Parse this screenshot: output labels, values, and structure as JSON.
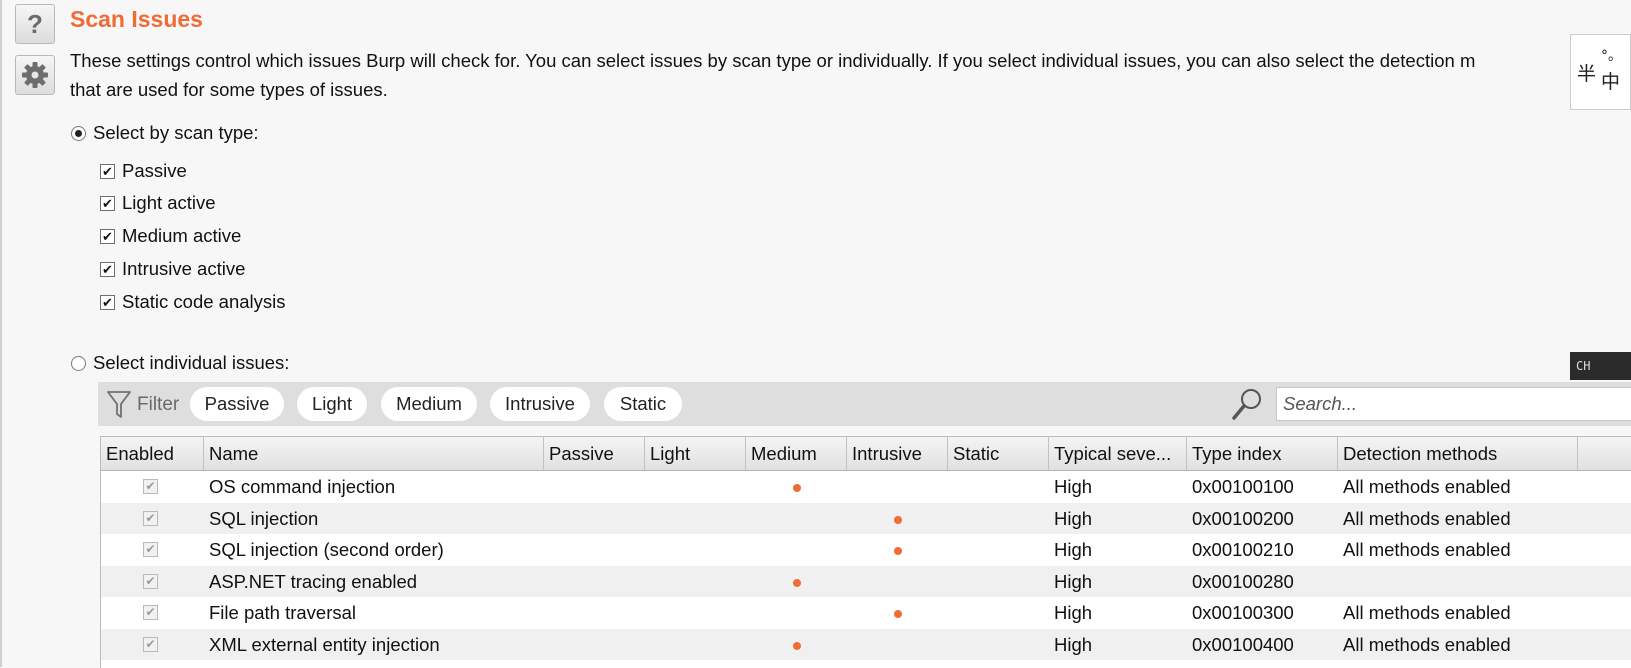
{
  "page": {
    "title": "Scan Issues",
    "description_line1": "These settings control which issues Burp will check for. You can select issues by scan type or individually. If you select individual issues, you can also select the detection m",
    "description_line2": "that are used for some types of issues."
  },
  "selection": {
    "by_scan_type_label": "Select by scan type:",
    "by_scan_type_selected": true,
    "individual_label": "Select individual issues:",
    "individual_selected": false,
    "scan_types": [
      {
        "label": "Passive",
        "checked": true
      },
      {
        "label": "Light active",
        "checked": true
      },
      {
        "label": "Medium active",
        "checked": true
      },
      {
        "label": "Intrusive active",
        "checked": true
      },
      {
        "label": "Static code analysis",
        "checked": true
      }
    ]
  },
  "filter": {
    "label": "Filter",
    "chips": [
      "Passive",
      "Light",
      "Medium",
      "Intrusive",
      "Static"
    ],
    "search_placeholder": "Search..."
  },
  "table": {
    "headers": [
      "Enabled",
      "Name",
      "Passive",
      "Light",
      "Medium",
      "Intrusive",
      "Static",
      "Typical seve...",
      "Type index",
      "Detection methods"
    ],
    "rows": [
      {
        "enabled": true,
        "name": "OS command injection",
        "scan": "Medium",
        "severity": "High",
        "type_index": "0x00100100",
        "detection": "All methods enabled"
      },
      {
        "enabled": true,
        "name": "SQL injection",
        "scan": "Intrusive",
        "severity": "High",
        "type_index": "0x00100200",
        "detection": "All methods enabled"
      },
      {
        "enabled": true,
        "name": "SQL injection (second order)",
        "scan": "Intrusive",
        "severity": "High",
        "type_index": "0x00100210",
        "detection": "All methods enabled"
      },
      {
        "enabled": true,
        "name": "ASP.NET tracing enabled",
        "scan": "Medium",
        "severity": "High",
        "type_index": "0x00100280",
        "detection": ""
      },
      {
        "enabled": true,
        "name": "File path traversal",
        "scan": "Intrusive",
        "severity": "High",
        "type_index": "0x00100300",
        "detection": "All methods enabled"
      },
      {
        "enabled": true,
        "name": "XML external entity injection",
        "scan": "Medium",
        "severity": "High",
        "type_index": "0x00100400",
        "detection": "All methods enabled"
      }
    ]
  },
  "overlay": {
    "ime_label": "CH",
    "logo_chars": [
      "半",
      "°。",
      "中"
    ]
  },
  "colors": {
    "accent": "#ef6c37",
    "background": "#f7f7f7",
    "filterbar": "#dedede",
    "alt_row": "#f0f0f0"
  },
  "icons": [
    "help-icon",
    "gear-icon",
    "funnel-icon",
    "magnifier-icon"
  ]
}
